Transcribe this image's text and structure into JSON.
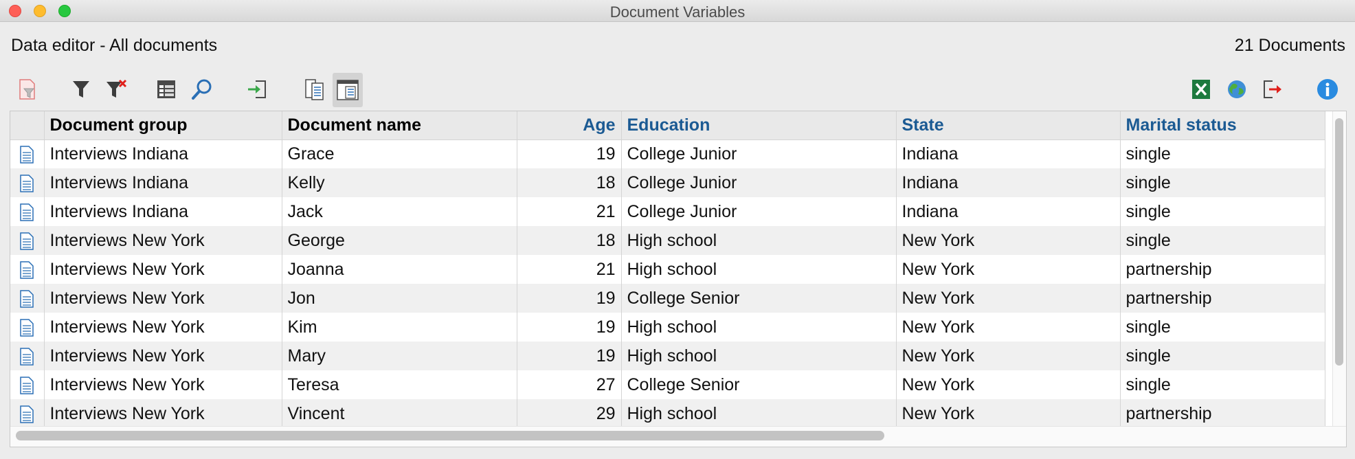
{
  "window": {
    "title": "Document Variables"
  },
  "header": {
    "subtitle": "Data editor - All documents",
    "document_count": "21 Documents"
  },
  "toolbar": {
    "left": [
      {
        "name": "document-filter-icon"
      },
      {
        "name": "filter-icon"
      },
      {
        "name": "clear-filter-icon"
      },
      {
        "name": "column-list-icon"
      },
      {
        "name": "search-icon"
      },
      {
        "name": "import-icon"
      },
      {
        "name": "document-list-icon"
      },
      {
        "name": "document-view-icon",
        "active": true
      }
    ],
    "right": [
      {
        "name": "excel-export-icon"
      },
      {
        "name": "html-export-icon"
      },
      {
        "name": "exit-icon"
      },
      {
        "name": "info-icon"
      }
    ]
  },
  "table": {
    "columns": [
      {
        "label": "",
        "kind": "icon"
      },
      {
        "label": "Document group",
        "kind": "system"
      },
      {
        "label": "Document name",
        "kind": "system"
      },
      {
        "label": "Age",
        "kind": "variable",
        "align": "right"
      },
      {
        "label": "Education",
        "kind": "variable"
      },
      {
        "label": "State",
        "kind": "variable"
      },
      {
        "label": "Marital status",
        "kind": "variable"
      }
    ],
    "rows": [
      [
        "Interviews Indiana",
        "Grace",
        "19",
        "College Junior",
        "Indiana",
        "single"
      ],
      [
        "Interviews Indiana",
        "Kelly",
        "18",
        "College Junior",
        "Indiana",
        "single"
      ],
      [
        "Interviews Indiana",
        "Jack",
        "21",
        "College Junior",
        "Indiana",
        "single"
      ],
      [
        "Interviews New York",
        "George",
        "18",
        "High school",
        "New York",
        "single"
      ],
      [
        "Interviews New York",
        "Joanna",
        "21",
        "High school",
        "New York",
        "partnership"
      ],
      [
        "Interviews New York",
        "Jon",
        "19",
        "College Senior",
        "New York",
        "partnership"
      ],
      [
        "Interviews New York",
        "Kim",
        "19",
        "High school",
        "New York",
        "single"
      ],
      [
        "Interviews New York",
        "Mary",
        "19",
        "High school",
        "New York",
        "single"
      ],
      [
        "Interviews New York",
        "Teresa",
        "27",
        "College Senior",
        "New York",
        "single"
      ],
      [
        "Interviews New York",
        "Vincent",
        "29",
        "High school",
        "New York",
        "partnership"
      ]
    ]
  },
  "colors": {
    "variable_header": "#1b5a93",
    "doc_icon": "#2a6fb5"
  }
}
